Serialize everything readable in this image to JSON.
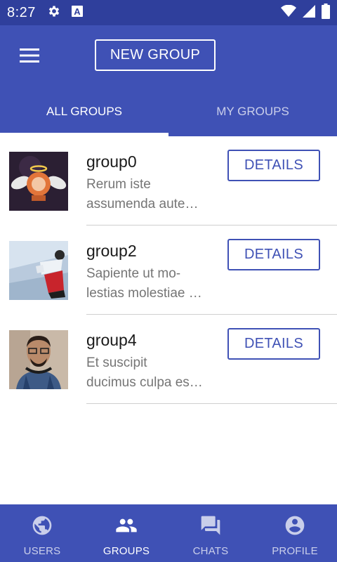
{
  "status_bar": {
    "time": "8:27",
    "icons": [
      "gear-icon",
      "a-letter-icon",
      "wifi-icon",
      "signal-icon",
      "battery-icon"
    ]
  },
  "app_bar": {
    "menu_icon": "hamburger-menu-icon",
    "new_group_label": "NEW GROUP",
    "tabs": [
      {
        "label": "ALL GROUPS",
        "active": true
      },
      {
        "label": "MY GROUPS",
        "active": false
      }
    ]
  },
  "groups": [
    {
      "name": "group0",
      "desc_line1": "Rerum iste",
      "desc_line2": "assumenda aute…",
      "details_label": "DETAILS"
    },
    {
      "name": "group2",
      "desc_line1": "Sapiente ut mo-",
      "desc_line2": "lestias molestiae …",
      "details_label": "DETAILS"
    },
    {
      "name": "group4",
      "desc_line1": "Et suscipit",
      "desc_line2": "ducimus culpa es…",
      "details_label": "DETAILS"
    }
  ],
  "bottom_nav": [
    {
      "label": "USERS",
      "icon": "globe-icon",
      "active": false
    },
    {
      "label": "GROUPS",
      "icon": "people-icon",
      "active": true
    },
    {
      "label": "CHATS",
      "icon": "chat-bubbles-icon",
      "active": false
    },
    {
      "label": "PROFILE",
      "icon": "account-circle-icon",
      "active": false
    }
  ],
  "colors": {
    "primary": "#3f51b5",
    "primary_dark": "#2f3f9c",
    "divider": "#cfcfcf"
  }
}
